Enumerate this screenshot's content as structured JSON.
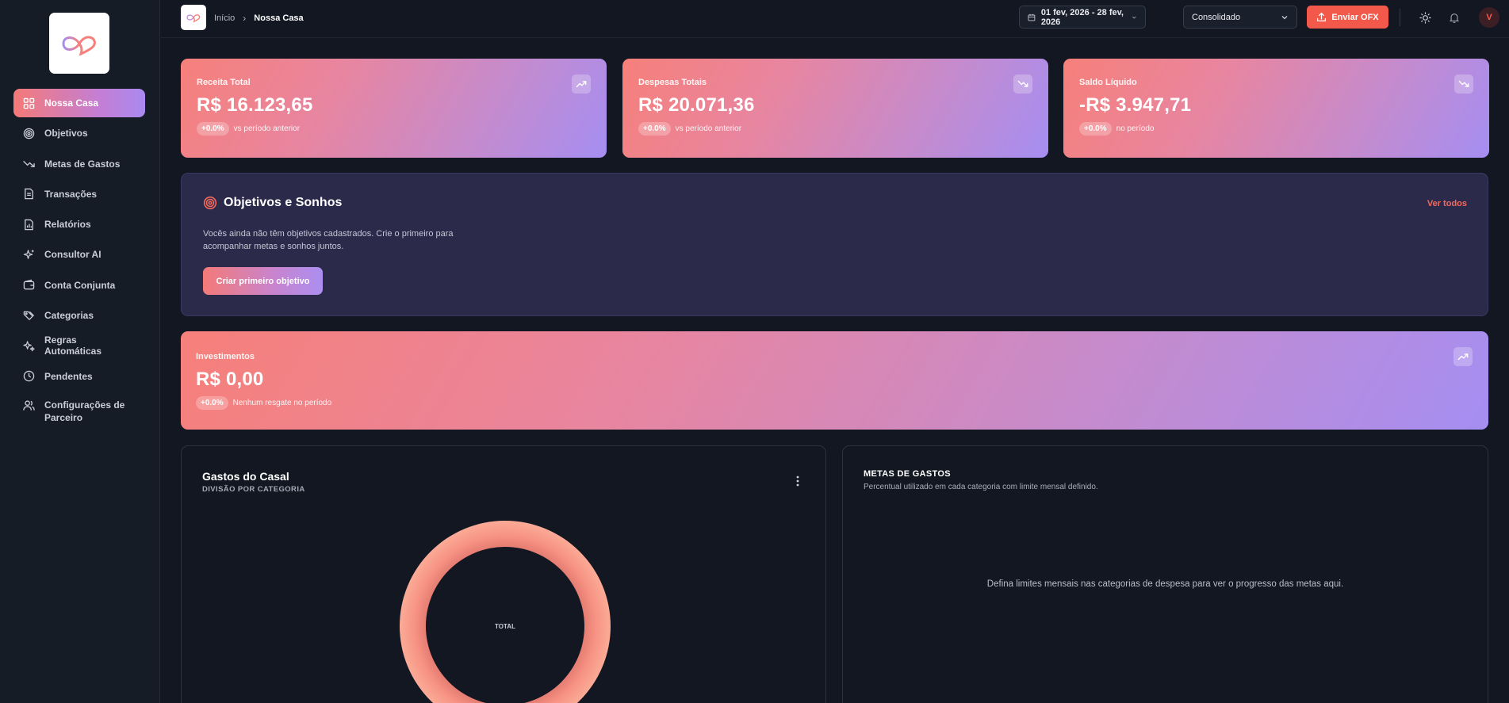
{
  "sidebar": {
    "items": [
      {
        "label": "Nossa Casa",
        "icon": "grid-icon",
        "active": true
      },
      {
        "label": "Objetivos",
        "icon": "target-icon"
      },
      {
        "label": "Metas de Gastos",
        "icon": "trend-down-icon"
      },
      {
        "label": "Transações",
        "icon": "document-icon"
      },
      {
        "label": "Relatórios",
        "icon": "report-icon"
      },
      {
        "label": "Consultor AI",
        "icon": "sparkles-icon"
      },
      {
        "label": "Conta Conjunta",
        "icon": "wallet-icon"
      },
      {
        "label": "Categorias",
        "icon": "tags-icon"
      },
      {
        "label": "Regras Automáticas",
        "icon": "auto-rules-icon"
      },
      {
        "label": "Pendentes",
        "icon": "clock-icon"
      },
      {
        "label": "Configurações de Parceiro",
        "icon": "users-icon"
      }
    ]
  },
  "topbar": {
    "breadcrumb": {
      "home": "Início",
      "current": "Nossa Casa"
    },
    "date_range": "01 fev, 2026 - 28 fev, 2026",
    "view_select": "Consolidado",
    "ofx_button": "Enviar OFX",
    "avatar_initial": "V"
  },
  "stats": {
    "revenue": {
      "label": "Receita Total",
      "value": "R$ 16.123,65",
      "change": "+0.0%",
      "note": "vs período anterior"
    },
    "expenses": {
      "label": "Despesas Totais",
      "value": "R$ 20.071,36",
      "change": "+0.0%",
      "note": "vs período anterior"
    },
    "balance": {
      "label": "Saldo Líquido",
      "value": "-R$ 3.947,71",
      "change": "+0.0%",
      "note": "no período"
    }
  },
  "goals": {
    "title": "Objetivos e Sonhos",
    "see_all": "Ver todos",
    "empty_text": "Vocês ainda não têm objetivos cadastrados. Crie o primeiro para acompanhar metas e sonhos juntos.",
    "create_button": "Criar primeiro objetivo"
  },
  "investments": {
    "label": "Investimentos",
    "value": "R$ 0,00",
    "change": "+0.0%",
    "note": "Nenhum resgate no período"
  },
  "couple_spending": {
    "title": "Gastos do Casal",
    "subtitle": "DIVISÃO POR CATEGORIA",
    "center_label": "TOTAL"
  },
  "spending_goals": {
    "title": "METAS DE GASTOS",
    "subtitle": "Percentual utilizado em cada categoria com limite mensal definido.",
    "empty_text": "Defina limites mensais nas categorias de despesa para ver o progresso das metas aqui."
  },
  "colors": {
    "accent": "#f2594b",
    "gradient_start": "#f6807a",
    "gradient_end": "#a58ef2",
    "background": "#121722"
  }
}
